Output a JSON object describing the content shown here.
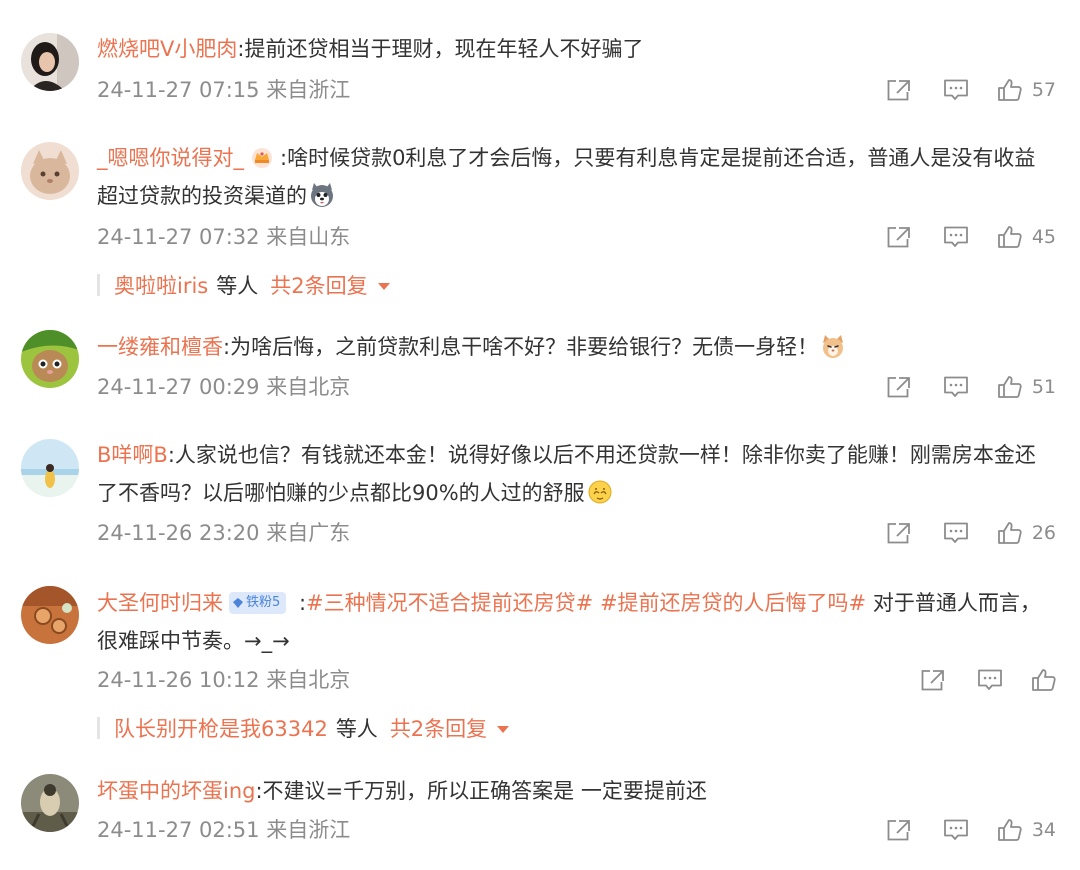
{
  "comments": [
    {
      "user": "燃烧吧V小肥肉",
      "text": ":提前还贷相当于理财，现在年轻人不好骗了",
      "time": "24-11-27 07:15",
      "location": "来自浙江",
      "likes": "57"
    },
    {
      "user": "_嗯嗯你说得对_",
      "text": ":啥时候贷款0利息了才会后悔，只要有利息肯定是提前还合适，普通人是没有收益超过贷款的投资渠道的",
      "time": "24-11-27 07:32",
      "location": "来自山东",
      "likes": "45",
      "replies": {
        "name": "奥啦啦iris",
        "others": "等人",
        "total": "共2条回复"
      }
    },
    {
      "user": "一缕雍和檀香",
      "text": ":为啥后悔，之前贷款利息干啥不好？非要给银行？无债一身轻！",
      "time": "24-11-27 00:29",
      "location": "来自北京",
      "likes": "51"
    },
    {
      "user": "B咩啊B",
      "text": ":人家说也信？有钱就还本金！说得好像以后不用还贷款一样！除非你卖了能赚！刚需房本金还了不香吗？以后哪怕赚的少点都比90%的人过的舒服",
      "time": "24-11-26 23:20",
      "location": "来自广东",
      "likes": "26"
    },
    {
      "user": "大圣何时归来",
      "fan_badge": "铁粉5",
      "text_prefix": " :",
      "topic1": "#三种情况不适合提前还房贷#",
      "topic2": "#提前还房贷的人后悔了吗#",
      "text": " 对于普通人而言，很难踩中节奏。→_→",
      "time": "24-11-26 10:12",
      "location": "来自北京",
      "likes": "",
      "replies": {
        "name": "队长别开枪是我63342",
        "others": "等人",
        "total": "共2条回复"
      }
    },
    {
      "user": "坏蛋中的坏蛋ing",
      "text": ":不建议=千万别，所以正确答案是 一定要提前还",
      "time": "24-11-27 02:51",
      "location": "来自浙江",
      "likes": "34"
    }
  ],
  "icons": {
    "share": "share-icon",
    "comment": "comment-icon",
    "like": "thumbs-up-icon",
    "reply_caret": "caret-down-icon"
  },
  "colors": {
    "username": "#eb7350",
    "meta": "#8c8c8c",
    "text": "#333333",
    "fan_badge_bg": "#dde9fb",
    "fan_badge_text": "#4b84d8"
  }
}
